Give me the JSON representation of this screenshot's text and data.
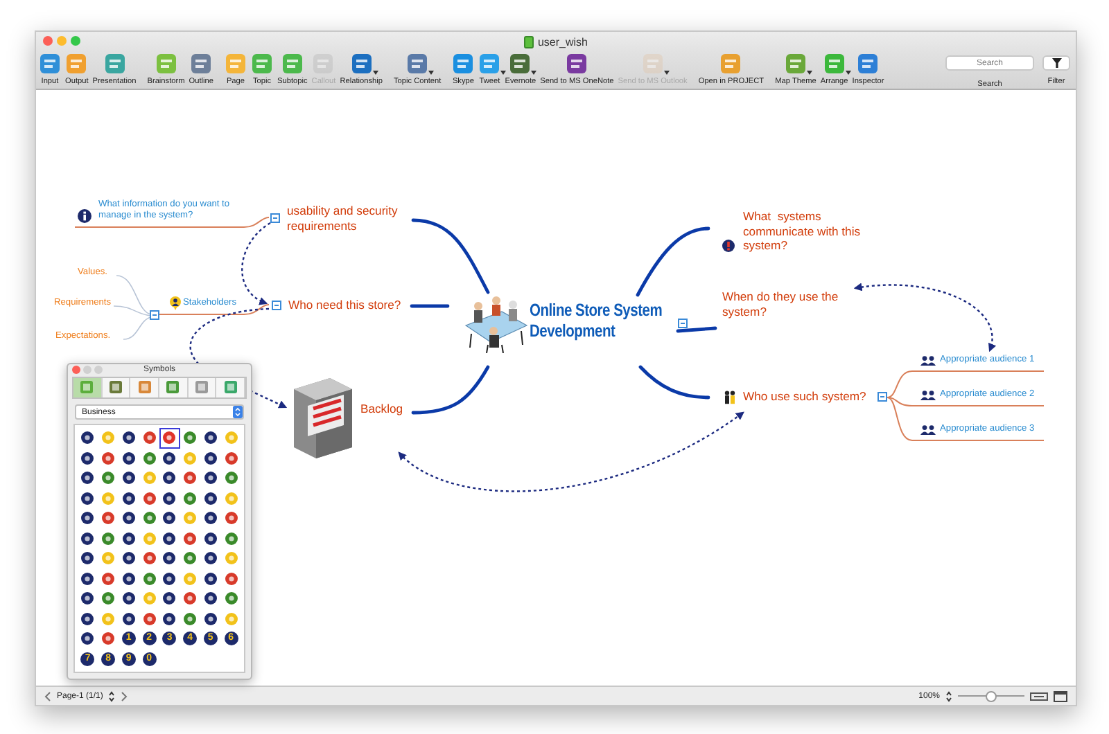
{
  "window": {
    "title": "user_wish"
  },
  "toolbar": {
    "items": [
      {
        "label": "Input",
        "disabled": false,
        "dropdown": false
      },
      {
        "label": "Output",
        "disabled": false,
        "dropdown": false
      },
      {
        "label": "Presentation",
        "disabled": false,
        "dropdown": false
      },
      {
        "label": "Brainstorm",
        "disabled": false,
        "dropdown": false
      },
      {
        "label": "Outline",
        "disabled": false,
        "dropdown": false
      },
      {
        "label": "Page",
        "disabled": false,
        "dropdown": false
      },
      {
        "label": "Topic",
        "disabled": false,
        "dropdown": false
      },
      {
        "label": "Subtopic",
        "disabled": false,
        "dropdown": false
      },
      {
        "label": "Callout",
        "disabled": true,
        "dropdown": false
      },
      {
        "label": "Relationship",
        "disabled": false,
        "dropdown": true
      },
      {
        "label": "Topic Content",
        "disabled": false,
        "dropdown": true
      },
      {
        "label": "Skype",
        "disabled": false,
        "dropdown": false
      },
      {
        "label": "Tweet",
        "disabled": false,
        "dropdown": true
      },
      {
        "label": "Evernote",
        "disabled": false,
        "dropdown": true
      },
      {
        "label": "Send to MS OneNote",
        "disabled": false,
        "dropdown": false
      },
      {
        "label": "Send to MS Outlook",
        "disabled": true,
        "dropdown": true
      },
      {
        "label": "Open in PROJECT",
        "disabled": false,
        "dropdown": false
      },
      {
        "label": "Map Theme",
        "disabled": false,
        "dropdown": true
      },
      {
        "label": "Arrange",
        "disabled": false,
        "dropdown": true
      },
      {
        "label": "Inspector",
        "disabled": false,
        "dropdown": false
      }
    ],
    "search": {
      "placeholder": "Search",
      "label": "Search"
    },
    "filter": {
      "label": "Filter"
    }
  },
  "map": {
    "central": {
      "title": "Online Store System Development",
      "expanded": true
    },
    "topics": [
      {
        "text": "usability and security requirements",
        "expanded": true,
        "children": [
          {
            "text": "What information do you want to manage in the system?"
          }
        ]
      },
      {
        "text": "Who need this store?",
        "expanded": true,
        "children": [
          {
            "text": "Stakeholders",
            "expanded": true,
            "children": [
              {
                "text": "Values."
              },
              {
                "text": "Requirements"
              },
              {
                "text": "Expectations."
              }
            ]
          }
        ]
      },
      {
        "text": "Backlog"
      },
      {
        "text": "What  systems communicate with this system?"
      },
      {
        "text": "When do they use the system?"
      },
      {
        "text": "Who use such system?",
        "expanded": true,
        "children": [
          {
            "text": "Appropriate audience 1"
          },
          {
            "text": "Appropriate audience 2"
          },
          {
            "text": "Appropriate audience 3"
          }
        ]
      }
    ]
  },
  "symbols_panel": {
    "title": "Symbols",
    "tabs": [
      {
        "selected": true
      },
      {
        "selected": false
      },
      {
        "selected": false
      },
      {
        "selected": false
      },
      {
        "selected": false
      },
      {
        "selected": false
      }
    ],
    "category": "Business",
    "items": [
      {
        "kind": "symbol",
        "selected": false
      },
      {
        "kind": "symbol",
        "selected": false
      },
      {
        "kind": "symbol",
        "selected": false
      },
      {
        "kind": "symbol",
        "selected": false
      },
      {
        "kind": "symbol",
        "selected": true
      },
      {
        "kind": "symbol",
        "selected": false
      },
      {
        "kind": "symbol",
        "selected": false
      },
      {
        "kind": "symbol",
        "selected": false
      },
      {
        "kind": "symbol",
        "selected": false
      },
      {
        "kind": "symbol",
        "selected": false
      },
      {
        "kind": "symbol",
        "selected": false
      },
      {
        "kind": "symbol",
        "selected": false
      },
      {
        "kind": "symbol",
        "selected": false
      },
      {
        "kind": "symbol",
        "selected": false
      },
      {
        "kind": "symbol",
        "selected": false
      },
      {
        "kind": "symbol",
        "selected": false
      },
      {
        "kind": "symbol",
        "selected": false
      },
      {
        "kind": "symbol",
        "selected": false
      },
      {
        "kind": "symbol",
        "selected": false
      },
      {
        "kind": "symbol",
        "selected": false
      },
      {
        "kind": "symbol",
        "selected": false
      },
      {
        "kind": "symbol",
        "selected": false
      },
      {
        "kind": "symbol",
        "selected": false
      },
      {
        "kind": "symbol",
        "selected": false
      },
      {
        "kind": "symbol",
        "selected": false
      },
      {
        "kind": "symbol",
        "selected": false
      },
      {
        "kind": "symbol",
        "selected": false
      },
      {
        "kind": "symbol",
        "selected": false
      },
      {
        "kind": "symbol",
        "selected": false
      },
      {
        "kind": "symbol",
        "selected": false
      },
      {
        "kind": "symbol",
        "selected": false
      },
      {
        "kind": "symbol",
        "selected": false
      },
      {
        "kind": "symbol",
        "selected": false
      },
      {
        "kind": "symbol",
        "selected": false
      },
      {
        "kind": "symbol",
        "selected": false
      },
      {
        "kind": "symbol",
        "selected": false
      },
      {
        "kind": "symbol",
        "selected": false
      },
      {
        "kind": "symbol",
        "selected": false
      },
      {
        "kind": "symbol",
        "selected": false
      },
      {
        "kind": "symbol",
        "selected": false
      },
      {
        "kind": "symbol",
        "selected": false
      },
      {
        "kind": "symbol",
        "selected": false
      },
      {
        "kind": "symbol",
        "selected": false
      },
      {
        "kind": "symbol",
        "selected": false
      },
      {
        "kind": "symbol",
        "selected": false
      },
      {
        "kind": "symbol",
        "selected": false
      },
      {
        "kind": "symbol",
        "selected": false
      },
      {
        "kind": "symbol",
        "selected": false
      },
      {
        "kind": "symbol",
        "selected": false
      },
      {
        "kind": "symbol",
        "selected": false
      },
      {
        "kind": "symbol",
        "selected": false
      },
      {
        "kind": "symbol",
        "selected": false
      },
      {
        "kind": "symbol",
        "selected": false
      },
      {
        "kind": "symbol",
        "selected": false
      },
      {
        "kind": "symbol",
        "selected": false
      },
      {
        "kind": "symbol",
        "selected": false
      },
      {
        "kind": "symbol",
        "selected": false
      },
      {
        "kind": "symbol",
        "selected": false
      },
      {
        "kind": "symbol",
        "selected": false
      },
      {
        "kind": "symbol",
        "selected": false
      },
      {
        "kind": "symbol",
        "selected": false
      },
      {
        "kind": "symbol",
        "selected": false
      },
      {
        "kind": "symbol",
        "selected": false
      },
      {
        "kind": "symbol",
        "selected": false
      },
      {
        "kind": "symbol",
        "selected": false
      },
      {
        "kind": "symbol",
        "selected": false
      },
      {
        "kind": "symbol",
        "selected": false
      },
      {
        "kind": "symbol",
        "selected": false
      },
      {
        "kind": "symbol",
        "selected": false
      },
      {
        "kind": "symbol",
        "selected": false
      },
      {
        "kind": "symbol",
        "selected": false
      },
      {
        "kind": "symbol",
        "selected": false
      },
      {
        "kind": "symbol",
        "selected": false
      },
      {
        "kind": "symbol",
        "selected": false
      },
      {
        "kind": "symbol",
        "selected": false
      },
      {
        "kind": "symbol",
        "selected": false
      },
      {
        "kind": "symbol",
        "selected": false
      },
      {
        "kind": "symbol",
        "selected": false
      },
      {
        "kind": "symbol",
        "selected": false
      },
      {
        "kind": "symbol",
        "selected": false
      },
      {
        "kind": "symbol",
        "selected": false
      },
      {
        "kind": "symbol",
        "selected": false
      },
      {
        "kind": "number",
        "text": "1",
        "selected": false
      },
      {
        "kind": "number",
        "text": "2",
        "selected": false
      },
      {
        "kind": "number",
        "text": "3",
        "selected": false
      },
      {
        "kind": "number",
        "text": "4",
        "selected": false
      },
      {
        "kind": "number",
        "text": "5",
        "selected": false
      },
      {
        "kind": "number",
        "text": "6",
        "selected": false
      },
      {
        "kind": "number",
        "text": "7",
        "selected": false
      },
      {
        "kind": "number",
        "text": "8",
        "selected": false
      },
      {
        "kind": "number",
        "text": "9",
        "selected": false
      },
      {
        "kind": "number",
        "text": "0",
        "selected": false
      }
    ]
  },
  "status_bar": {
    "page": "Page-1 (1/1)",
    "zoom": "100%",
    "zoom_slider": {
      "level": 0.5
    }
  }
}
